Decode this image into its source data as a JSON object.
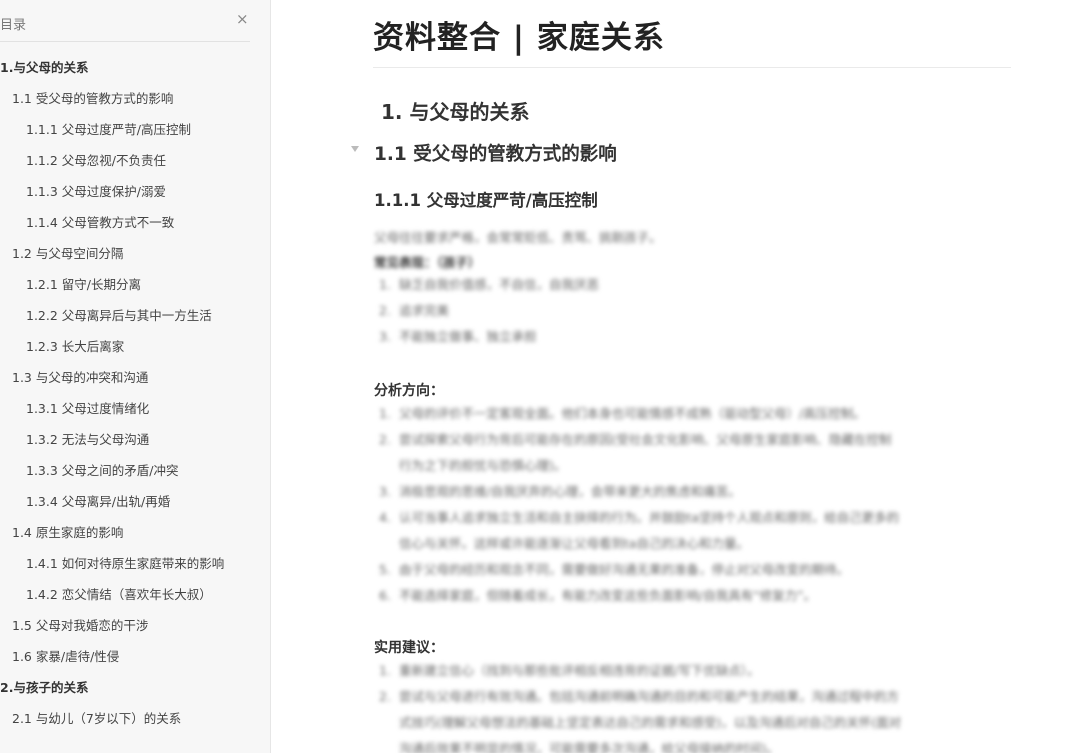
{
  "sidebar": {
    "title": "目录",
    "close_icon": "×",
    "items": [
      {
        "label": "1.与父母的关系",
        "level": 1
      },
      {
        "label": "1.1 受父母的管教方式的影响",
        "level": 2
      },
      {
        "label": "1.1.1 父母过度严苛/高压控制",
        "level": 3
      },
      {
        "label": "1.1.2 父母忽视/不负责任",
        "level": 3
      },
      {
        "label": "1.1.3 父母过度保护/溺爱",
        "level": 3
      },
      {
        "label": "1.1.4 父母管教方式不一致",
        "level": 3
      },
      {
        "label": "1.2 与父母空间分隔",
        "level": 2
      },
      {
        "label": "1.2.1 留守/长期分离",
        "level": 3
      },
      {
        "label": "1.2.2 父母离异后与其中一方生活",
        "level": 3
      },
      {
        "label": "1.2.3 长大后离家",
        "level": 3
      },
      {
        "label": "1.3 与父母的冲突和沟通",
        "level": 2
      },
      {
        "label": "1.3.1 父母过度情绪化",
        "level": 3
      },
      {
        "label": "1.3.2 无法与父母沟通",
        "level": 3
      },
      {
        "label": "1.3.3 父母之间的矛盾/冲突",
        "level": 3
      },
      {
        "label": "1.3.4 父母离异/出轨/再婚",
        "level": 3
      },
      {
        "label": "1.4 原生家庭的影响",
        "level": 2
      },
      {
        "label": "1.4.1 如何对待原生家庭带来的影响",
        "level": 3
      },
      {
        "label": "1.4.2 恋父情结（喜欢年长大叔）",
        "level": 3
      },
      {
        "label": "1.5 父母对我婚恋的干涉",
        "level": 2
      },
      {
        "label": "1.6 家暴/虐待/性侵",
        "level": 2
      },
      {
        "label": "2.与孩子的关系",
        "level": 1
      },
      {
        "label": "2.1 与幼儿（7岁以下）的关系",
        "level": 2
      }
    ]
  },
  "doc": {
    "title": "资料整合 | 家庭关系",
    "h1": "1. 与父母的关系",
    "h2": "1.1 受父母的管教方式的影响",
    "h3": "1.1.1 父母过度严苛/高压控制",
    "intro": "父母往往要求严格，会常常贬低、责骂、挑剔孩子。",
    "common_label": "常见表现：（孩子）",
    "common_items": [
      "缺乏自我价值感，不自信，自我厌恶",
      "追求完美",
      "不能独立做事、独立承担"
    ],
    "analysis_label": "分析方向：",
    "analysis_items": [
      "父母的评价不一定客观全面。他们本身也可能情感不成熟（驱动型父母）/高压控制。",
      "尝试探索父母行为背后可能存在的原因(受社会文化影响、父母原生家庭影响、隐藏在控制",
      "行为之下的担忧与恐惧心理)。",
      "消极悲观的思维/自我厌弃的心理，会带来更大的焦虑和痛苦。",
      "认可当事人追求独立生活和自主抉择的行为。并鼓励ta坚持个人观点和原则，给自己更多的",
      "信心与关怀。这样或许能逐渐让父母看到ta自己的决心和力量。",
      "由于父母的经历和观念不同，需要做好沟通无果的准备，停止对父母改变的期待。",
      "不能选择家庭，但随着成长，有能力改变这些负面影响/自我具有“修复力”。"
    ],
    "analysis_nums": [
      "1.",
      "2.",
      "",
      "3.",
      "4.",
      "",
      "5.",
      "6."
    ],
    "advice_label": "实用建议：",
    "advice_items": [
      "重新建立信心（找到与那些批评相反相违背的证据/写下优缺点）。",
      "尝试与父母进行有效沟通。包括沟通前明确沟通的目的和可能产生的结果，沟通过程中的方",
      "式技巧(理解父母想法的基础上坚定表达自己的需求和感受)，以及沟通后对自己的关怀(面对",
      "沟通后效果不明显的情况，可能需要多次沟通，给父母接纳的时间)。"
    ],
    "advice_nums": [
      "1.",
      "2.",
      "",
      ""
    ]
  }
}
